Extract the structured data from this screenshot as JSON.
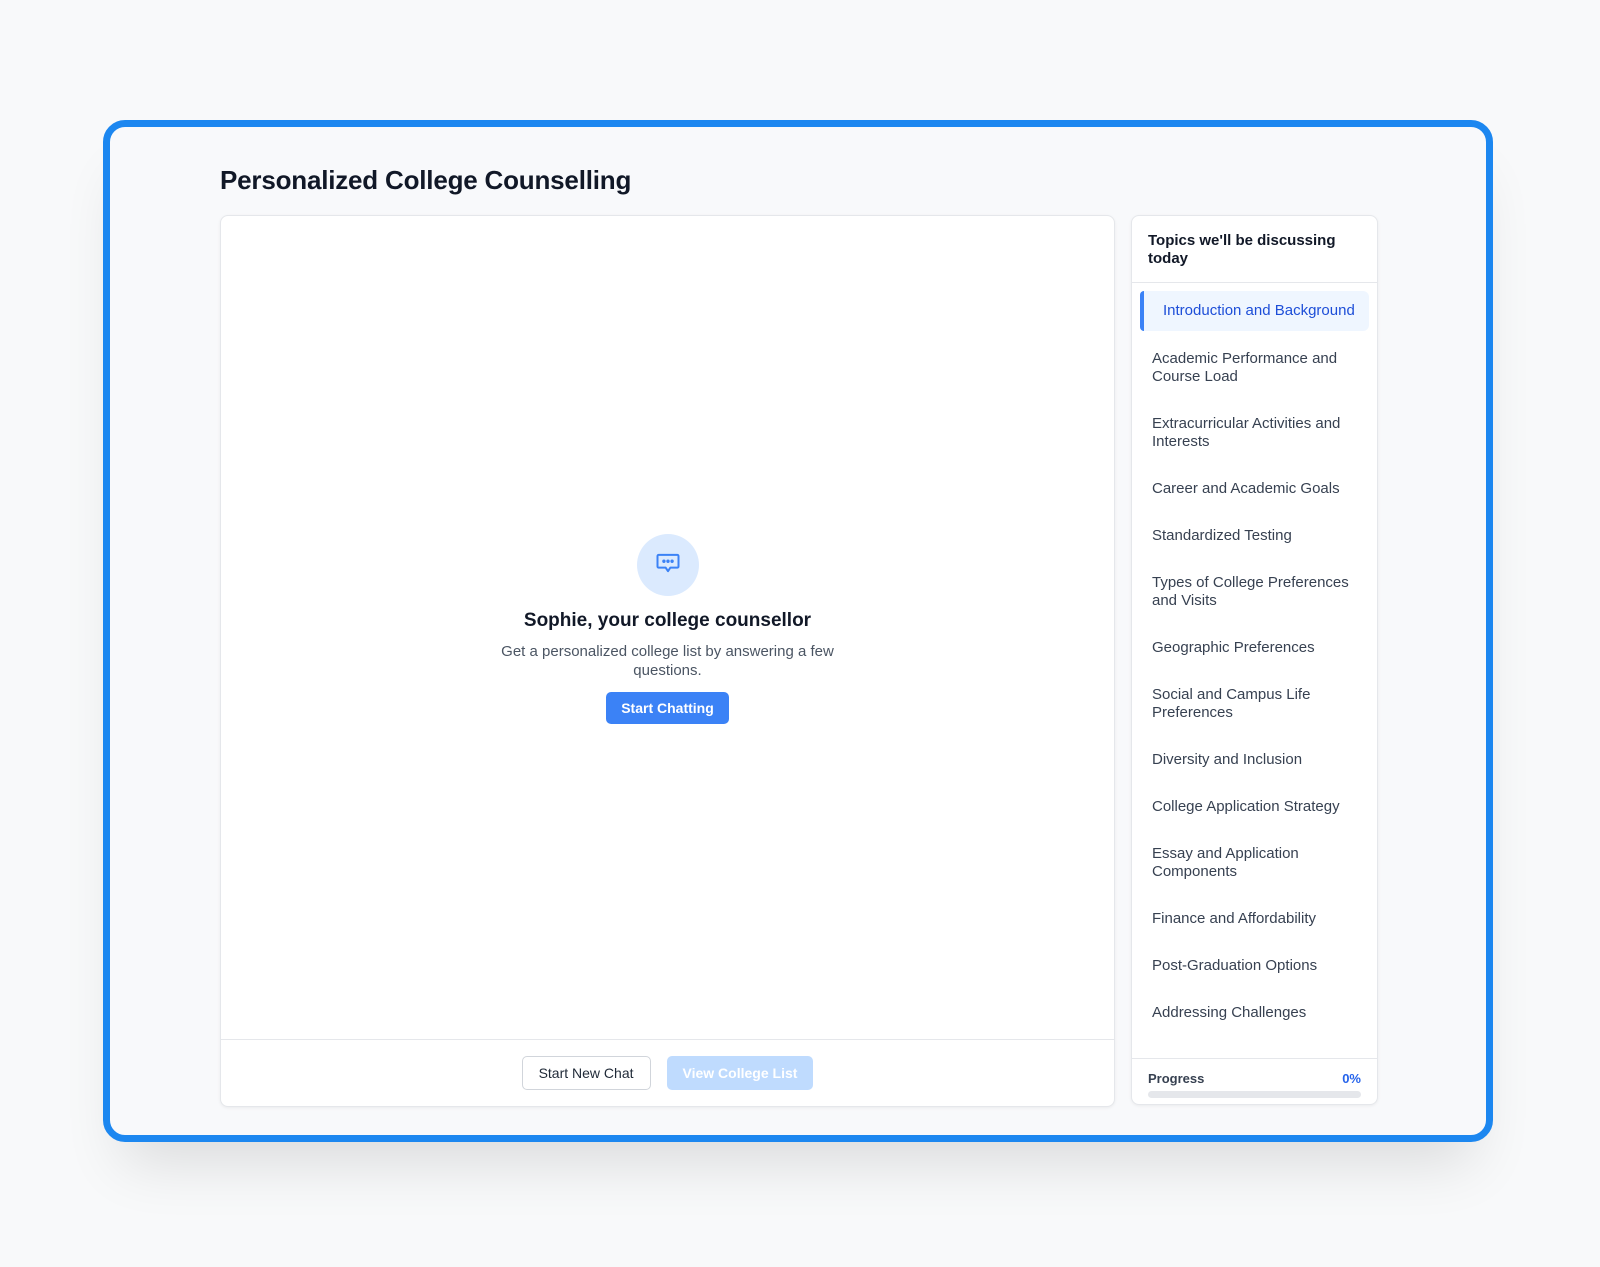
{
  "page": {
    "title": "Personalized College Counselling"
  },
  "chat": {
    "icon": "chat-bubble-icon",
    "counsellor_name": "Sophie, your college counsellor",
    "description": "Get a personalized college list by answering a few questions.",
    "start_button_label": "Start Chatting",
    "footer": {
      "new_chat_label": "Start New Chat",
      "view_list_label": "View College List",
      "view_list_enabled": false
    }
  },
  "topics": {
    "header": "Topics we'll be discussing today",
    "active_index": 0,
    "items": [
      {
        "label": "Introduction and Background"
      },
      {
        "label": "Academic Performance and Course Load"
      },
      {
        "label": "Extracurricular Activities and Interests"
      },
      {
        "label": "Career and Academic Goals"
      },
      {
        "label": "Standardized Testing"
      },
      {
        "label": "Types of College Preferences and Visits"
      },
      {
        "label": "Geographic Preferences"
      },
      {
        "label": "Social and Campus Life Preferences"
      },
      {
        "label": "Diversity and Inclusion"
      },
      {
        "label": "College Application Strategy"
      },
      {
        "label": "Essay and Application Components"
      },
      {
        "label": "Finance and Affordability"
      },
      {
        "label": "Post-Graduation Options"
      },
      {
        "label": "Addressing Challenges"
      }
    ],
    "progress": {
      "label": "Progress",
      "value_text": "0%",
      "fraction": 0
    }
  },
  "colors": {
    "frame_border": "#1c87f0",
    "accent": "#3b82f6",
    "accent_light": "#dbeafe",
    "disabled_button": "#bfdbfe",
    "active_topic_bg": "#eff6ff",
    "active_topic_text": "#1d4ed8"
  }
}
